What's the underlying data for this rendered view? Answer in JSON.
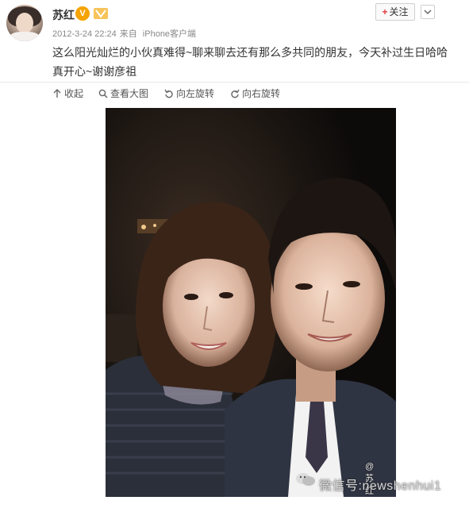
{
  "post": {
    "username": "苏红",
    "verified_badge": "V",
    "timestamp": "2012-3-24 22:24",
    "source_prefix": "来自",
    "source": "iPhone客户端",
    "follow_label": "关注",
    "content_line1": "这么阳光灿烂的小伙真难得~聊来聊去还有那么多共同的朋友，今天补过生日哈哈",
    "content_line2": "真开心~谢谢彦祖"
  },
  "toolbar": {
    "collapse": "收起",
    "view_large": "查看大图",
    "rotate_left": "向左旋转",
    "rotate_right": "向右旋转"
  },
  "watermark": {
    "at_user": "@苏红",
    "mark": "微信号:newshenhui1"
  },
  "colors": {
    "badge": "#f5a300",
    "follow_plus": "#e4393c",
    "meta_text": "#888888"
  },
  "icons": [
    "collapse-arrow-icon",
    "magnifier-icon",
    "rotate-left-icon",
    "rotate-right-icon",
    "more-chevron-icon",
    "wechat-logo-icon"
  ]
}
